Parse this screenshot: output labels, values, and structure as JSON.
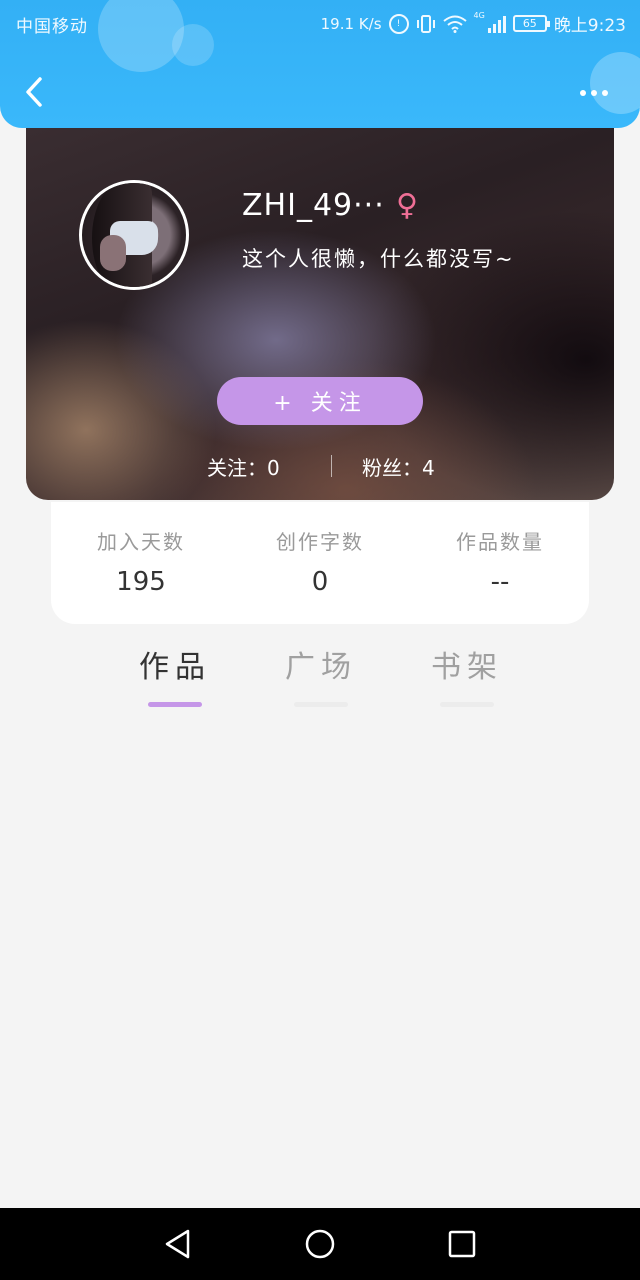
{
  "status_bar": {
    "carrier": "中国移动",
    "speed": "19.1 K/s",
    "network": "4G",
    "battery": "65",
    "time": "晚上9:23"
  },
  "header": {
    "back_icon": "chevron-left-icon",
    "more_icon": "more-dots-icon"
  },
  "profile": {
    "username": "ZHI_49···",
    "gender_symbol": "♀",
    "gender_color": "#ef6f96",
    "bio": "这个人很懒，什么都没写~",
    "follow_button": "+ 关注",
    "following": "关注：0",
    "fans": "粉丝：4"
  },
  "stats": [
    {
      "label": "加入天数",
      "value": "195"
    },
    {
      "label": "创作字数",
      "value": "0"
    },
    {
      "label": "作品数量",
      "value": "--"
    }
  ],
  "tabs": [
    {
      "label": "作品",
      "active": true
    },
    {
      "label": "广场",
      "active": false
    },
    {
      "label": "书架",
      "active": false
    }
  ],
  "colors": {
    "header_blue": "#3ab8fb",
    "accent_purple": "#c596e8",
    "background": "#f4f4f4"
  }
}
